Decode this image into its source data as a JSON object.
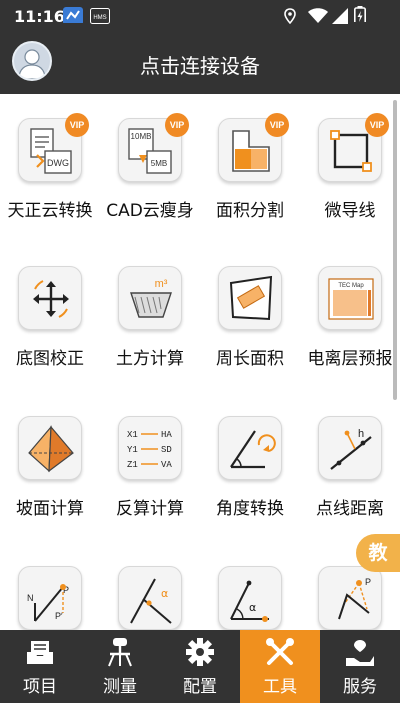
{
  "status_bar": {
    "time": "11:16",
    "notification_icons": [
      "app-notification-icon",
      "hms-icon"
    ],
    "hms_badge": "HMS",
    "system_icons": [
      "location-icon",
      "wifi-icon",
      "signal-icon",
      "battery-icon"
    ]
  },
  "header": {
    "title": "点击连接设备"
  },
  "tools": [
    {
      "label": "天正云转换",
      "icon": "dwg-convert-icon",
      "vip": true
    },
    {
      "label": "CAD云瘦身",
      "icon": "cad-slim-icon",
      "vip": true
    },
    {
      "label": "面积分割",
      "icon": "area-split-icon",
      "vip": true
    },
    {
      "label": "微导线",
      "icon": "micro-traverse-icon",
      "vip": true
    },
    {
      "label": "底图校正",
      "icon": "basemap-correct-icon",
      "vip": false
    },
    {
      "label": "土方计算",
      "icon": "earthwork-icon",
      "vip": false
    },
    {
      "label": "周长面积",
      "icon": "perimeter-area-icon",
      "vip": false
    },
    {
      "label": "电离层预报",
      "icon": "ionosphere-icon",
      "vip": false
    },
    {
      "label": "坡面计算",
      "icon": "slope-icon",
      "vip": false
    },
    {
      "label": "反算计算",
      "icon": "inverse-calc-icon",
      "vip": false
    },
    {
      "label": "角度转换",
      "icon": "angle-convert-icon",
      "vip": false
    },
    {
      "label": "点线距离",
      "icon": "point-line-distance-icon",
      "vip": false
    },
    {
      "label": "",
      "icon": "bearing-icon",
      "vip": false
    },
    {
      "label": "",
      "icon": "intersection-icon",
      "vip": false
    },
    {
      "label": "",
      "icon": "angle-point-icon",
      "vip": false
    },
    {
      "label": "",
      "icon": "triangle-point-icon",
      "vip": false
    }
  ],
  "badges": {
    "vip": "VIP",
    "dwg": "DWG",
    "size_before": "10MB",
    "size_after": "5MB",
    "m3": "m³",
    "tec_map": "TEC Map",
    "calc_x1": "X1",
    "calc_y1": "Y1",
    "calc_z1": "Z1",
    "calc_ha": "HA",
    "calc_sd": "SD",
    "calc_va": "VA",
    "h": "h",
    "n": "N",
    "p": "P",
    "p_prime": "P′",
    "alpha": "α"
  },
  "floating_button": {
    "label": "教"
  },
  "tabs": [
    {
      "label": "项目",
      "icon": "project-icon",
      "active": false
    },
    {
      "label": "测量",
      "icon": "survey-icon",
      "active": false
    },
    {
      "label": "配置",
      "icon": "settings-icon",
      "active": false
    },
    {
      "label": "工具",
      "icon": "tools-icon",
      "active": true
    },
    {
      "label": "服务",
      "icon": "service-icon",
      "active": false
    }
  ],
  "colors": {
    "bar_bg": "#333333",
    "accent": "#f0901e",
    "vip": "#f08a24",
    "floating": "#f2b24a"
  }
}
